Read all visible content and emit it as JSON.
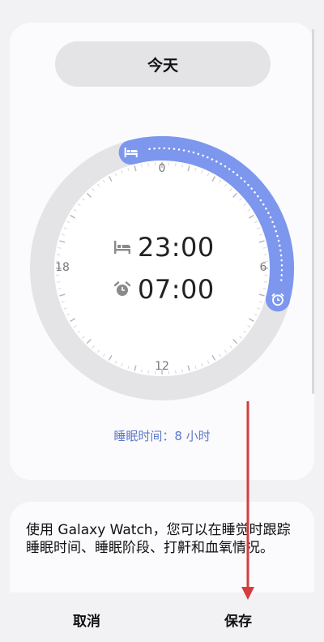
{
  "day_selector": {
    "label": "今天"
  },
  "dial": {
    "numbers": {
      "top": "0",
      "right": "6",
      "bottom": "12",
      "left": "18"
    },
    "accent_color": "#7d97ee",
    "track_color": "#e4e4e7"
  },
  "bedtime": {
    "time": "23:00",
    "icon": "bed-icon"
  },
  "wake": {
    "time": "07:00",
    "icon": "alarm-icon"
  },
  "summary": "睡眠时间：8 小时",
  "info": {
    "text": "使用 Galaxy Watch，您可以在睡觉时跟踪睡眠时间、睡眠阶段、打鼾和血氧情况。"
  },
  "actions": {
    "cancel": "取消",
    "save": "保存"
  }
}
